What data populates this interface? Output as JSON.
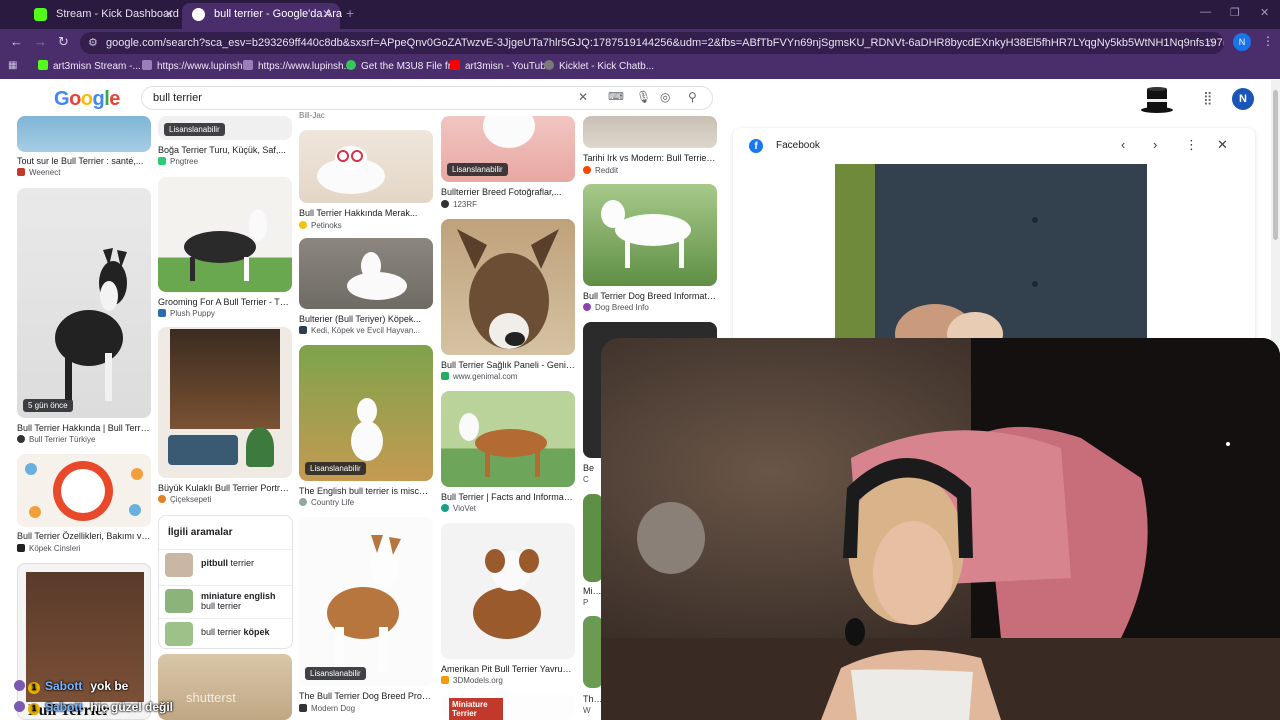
{
  "browser": {
    "tabs": [
      {
        "label": "Stream - Kick Dashboard",
        "active": false,
        "favicon_color": "#53fc18"
      },
      {
        "label": "bull terrier - Google'da Ara",
        "active": true,
        "favicon_color": "#ffffff"
      }
    ],
    "url": "google.com/search?sca_esv=b293269ff440c8db&sxsrf=APpeQnv0GoZATwzvE-3JjgeUTa7hlr5GJQ:1787519144256&udm=2&fbs=ABfTbFVYn69njSgmsKU_RDNVt-6aDHR8bycdEXnkyH38El5fhHR7LYqgNy5kb5WtNH1Nq9nfs197E1NJ0R3RQHGJztLmAwuWj91baAAJ0N...",
    "profile_initial": "N",
    "bookmarks": [
      {
        "label": "art3misn Stream -...",
        "icon_color": "#53fc18"
      },
      {
        "label": "https://www.lupinsh...",
        "icon_color": "#9b7fb8"
      },
      {
        "label": "https://www.lupinsh...",
        "icon_color": "#9b7fb8"
      },
      {
        "label": "Get the M3U8 File fr...",
        "icon_color": "#34c759"
      },
      {
        "label": "art3misn - YouTube",
        "icon_color": "#ff0000"
      },
      {
        "label": "Kicklet - Kick Chatb...",
        "icon_color": "#7a7a7a"
      }
    ]
  },
  "google": {
    "logo": "Google",
    "query": "bull terrier",
    "user_initial": "N"
  },
  "results": {
    "col1": [
      {
        "title": "Tout sur le Bull Terrier : santé,...",
        "source": "Weenect",
        "src_color": "#c0392b"
      },
      {
        "title": "Bull Terrier Hakkında | Bull Terrie...",
        "source": "Bull Terrier Türkiye",
        "src_color": "#333",
        "badge": "5 gün önce"
      },
      {
        "title": "Bull Terrier Özellikleri, Bakımı ve...",
        "source": "Köpek Cinsleri",
        "src_color": "#222"
      }
    ],
    "col2": [
      {
        "title": "Boğa Terrier Turu, Küçük, Saf,...",
        "source": "Pngtree",
        "src_color": "#2ecc71",
        "badge": "Lisanslanabilir"
      },
      {
        "title": "Grooming For A Bull Terrier - The...",
        "source": "Plush Puppy",
        "src_color": "#2b6cb0"
      },
      {
        "title": "Büyük Kulaklı Bull Terrier Portres...",
        "source": "Çiçeksepeti",
        "src_color": "#e67e22"
      }
    ],
    "col3": [
      {
        "title": "Bill-Jac",
        "source": ""
      },
      {
        "title": "Bull Terrier Hakkında Merak...",
        "source": "Petinoks",
        "src_color": "#f1c40f"
      },
      {
        "title": "Bulterier (Bull Teriyer) Köpek...",
        "source": "Kedi, Köpek ve Evcil Hayvan...",
        "src_color": "#2c3e50"
      },
      {
        "title": "The English bull terrier is mischi...",
        "source": "Country Life",
        "src_color": "#95a5a6",
        "badge": "Lisanslanabilir"
      },
      {
        "title": "The Bull Terrier Dog Breed Profil...",
        "source": "Modern Dog",
        "src_color": "#333",
        "badge": "Lisanslanabilir"
      }
    ],
    "col4": [
      {
        "title": "Bullterrier Breed Fotoğraflar,...",
        "source": "123RF",
        "src_color": "#e74c3c",
        "badge": "Lisanslanabilir"
      },
      {
        "title": "Bull Terrier Sağlık Paneli - Genim...",
        "source": "www.genimal.com",
        "src_color": "#27ae60"
      },
      {
        "title": "Bull Terrier | Facts and Informati...",
        "source": "VioVet",
        "src_color": "#16a085"
      },
      {
        "title": "Amerikan Pit Bull Terrier Yavrusu...",
        "source": "3DModels.org",
        "src_color": "#f39c12"
      },
      {
        "title": "Miniature Terrier",
        "source": ""
      }
    ],
    "col5": [
      {
        "title": "Tarihi Irk vs Modern: Bull Terrier :...",
        "source": "Reddit",
        "src_color": "#ff4500"
      },
      {
        "title": "Bull Terrier Dog Breed Informatio...",
        "source": "Dog Breed Info",
        "src_color": "#8e44ad"
      },
      {
        "title": "Be",
        "source": "C"
      },
      {
        "title": "Minia",
        "source": "P"
      },
      {
        "title": "The B",
        "source": "W"
      }
    ],
    "related": {
      "heading": "İlgili aramalar",
      "items": [
        {
          "bold": "pitbull",
          "rest": " terrier"
        },
        {
          "bold": "miniature english",
          "rest": "bull terrier"
        },
        {
          "bold": "köpek",
          "prefix": "bull terrier "
        }
      ]
    }
  },
  "panel": {
    "title": "Facebook"
  },
  "chat": [
    {
      "user": "Sabott",
      "badge_count": "1",
      "message": "yok be"
    },
    {
      "user": "Sabott",
      "badge_count": "1",
      "message": "hiç güzel değil"
    }
  ],
  "watermark": "shutterst",
  "thumb_caption": "Bull Terrier"
}
